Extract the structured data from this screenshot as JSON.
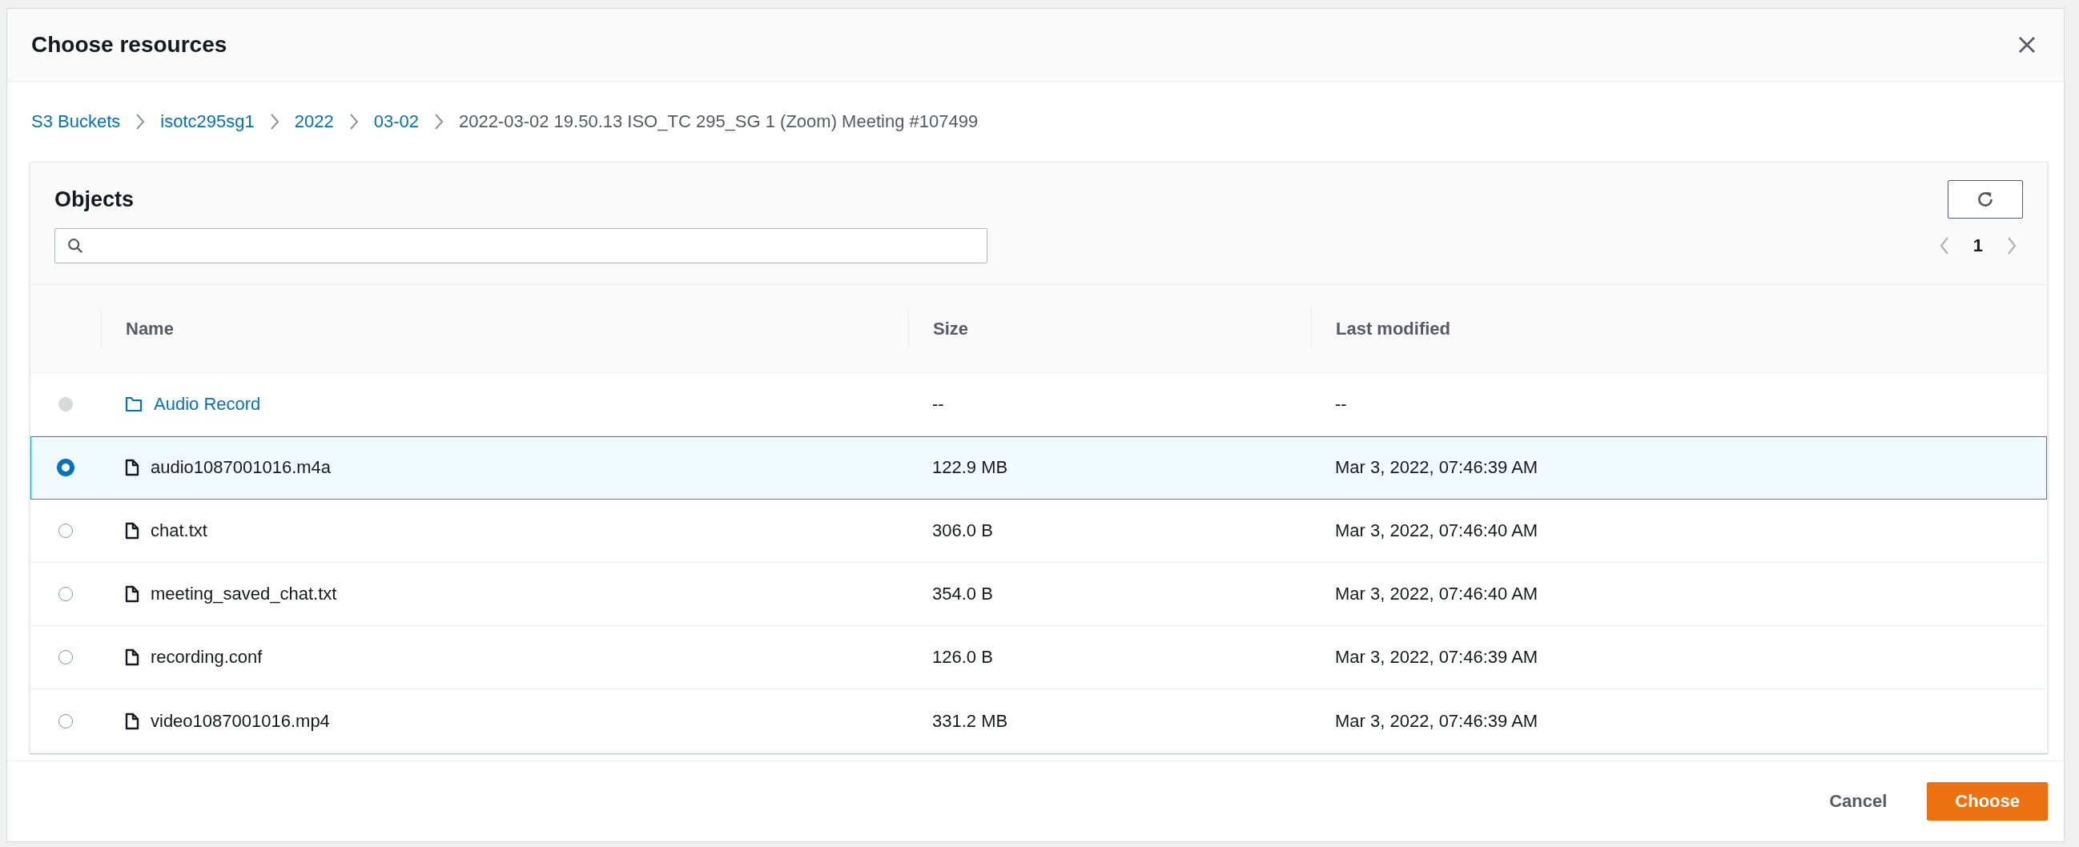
{
  "dialog": {
    "title": "Choose resources"
  },
  "breadcrumbs": [
    {
      "label": "S3 Buckets",
      "kind": "link"
    },
    {
      "label": "isotc295sg1",
      "kind": "link"
    },
    {
      "label": "2022",
      "kind": "link"
    },
    {
      "label": "03-02",
      "kind": "link"
    },
    {
      "label": "2022-03-02 19.50.13 ISO_TC 295_SG 1 (Zoom) Meeting #107499",
      "kind": "current"
    }
  ],
  "objects": {
    "title": "Objects",
    "pagination": {
      "page": "1"
    },
    "columns": [
      "Name",
      "Size",
      "Last modified"
    ],
    "rows": [
      {
        "kind": "folder",
        "name": "Audio Record",
        "size": "--",
        "modified": "--",
        "selected": false,
        "disabled": true
      },
      {
        "kind": "file",
        "name": "audio1087001016.m4a",
        "size": "122.9 MB",
        "modified": "Mar 3, 2022, 07:46:39 AM",
        "selected": true,
        "disabled": false
      },
      {
        "kind": "file",
        "name": "chat.txt",
        "size": "306.0 B",
        "modified": "Mar 3, 2022, 07:46:40 AM",
        "selected": false,
        "disabled": false
      },
      {
        "kind": "file",
        "name": "meeting_saved_chat.txt",
        "size": "354.0 B",
        "modified": "Mar 3, 2022, 07:46:40 AM",
        "selected": false,
        "disabled": false
      },
      {
        "kind": "file",
        "name": "recording.conf",
        "size": "126.0 B",
        "modified": "Mar 3, 2022, 07:46:39 AM",
        "selected": false,
        "disabled": false
      },
      {
        "kind": "file",
        "name": "video1087001016.mp4",
        "size": "331.2 MB",
        "modified": "Mar 3, 2022, 07:46:39 AM",
        "selected": false,
        "disabled": false
      }
    ]
  },
  "buttons": {
    "cancel": "Cancel",
    "confirm": "Choose"
  }
}
